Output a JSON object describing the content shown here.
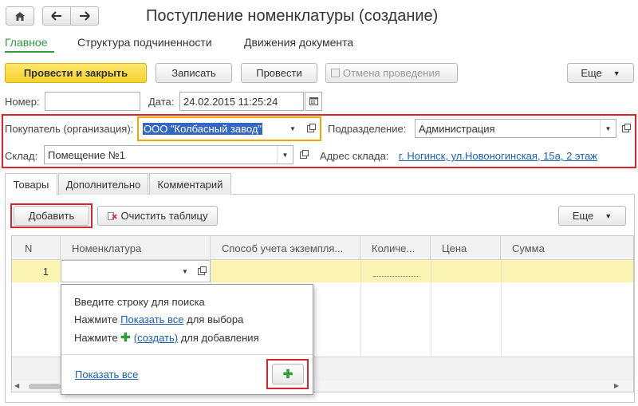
{
  "window": {
    "title": "Поступление номенклатуры (создание)"
  },
  "nav": {
    "home_icon": "home-icon",
    "back_icon": "arrow-left-icon",
    "forward_icon": "arrow-right-icon"
  },
  "sections": [
    "Главное",
    "Структура подчиненности",
    "Движения документа"
  ],
  "toolbar": {
    "post_close": "Провести и закрыть",
    "save": "Записать",
    "post": "Провести",
    "cancel_post": "Отмена проведения",
    "more": "Еще"
  },
  "header": {
    "number_label": "Номер:",
    "number_value": "",
    "date_label": "Дата:",
    "date_value": "24.02.2015 11:25:24",
    "buyer_label": "Покупатель (организация):",
    "buyer_value": "ООО \"Колбасный завод\"",
    "division_label": "Подразделение:",
    "division_value": "Администрация",
    "warehouse_label": "Склад:",
    "warehouse_value": "Помещение №1",
    "address_label": "Адрес склада:",
    "address_value": "г. Ногинск, ул.Новоногинская, 15а, 2 этаж"
  },
  "tabs": [
    "Товары",
    "Дополнительно",
    "Комментарий"
  ],
  "table_toolbar": {
    "add": "Добавить",
    "clear": "Очистить таблицу",
    "more": "Еще"
  },
  "table": {
    "columns": [
      "N",
      "Номенклатура",
      "Способ учета экземпля...",
      "Количе...",
      "Цена",
      "Сумма"
    ],
    "rows": [
      {
        "n": "1",
        "item": "",
        "method": "",
        "qty": "",
        "price": "",
        "sum": ""
      }
    ]
  },
  "dropdown": {
    "line1": "Введите строку для поиска",
    "line2_pre": "Нажмите ",
    "line2_link": "Показать все",
    "line2_post": " для выбора",
    "line3_pre": "Нажмите ",
    "line3_link": "(создать)",
    "line3_post": " для добавления",
    "show_all": "Показать все"
  },
  "colors": {
    "accent_yellow": "#f5d22f",
    "link_blue": "#1a5fb4",
    "green": "#2e9e3a",
    "highlight_red": "#d9232d",
    "row_yellow": "#fbf3b1",
    "focus_orange": "#f0a800"
  }
}
